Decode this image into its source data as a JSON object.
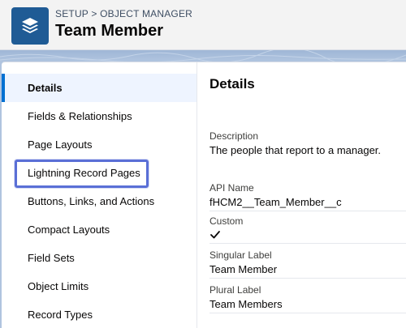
{
  "header": {
    "breadcrumb": {
      "setup": "SETUP",
      "separator": ">",
      "object_manager": "OBJECT MANAGER"
    },
    "title": "Team Member",
    "icon": "stack-layers-icon"
  },
  "sidebar": {
    "items": [
      {
        "label": "Details",
        "active": true
      },
      {
        "label": "Fields & Relationships"
      },
      {
        "label": "Page Layouts"
      },
      {
        "label": "Lightning Record Pages",
        "highlighted": true
      },
      {
        "label": "Buttons, Links, and Actions"
      },
      {
        "label": "Compact Layouts"
      },
      {
        "label": "Field Sets"
      },
      {
        "label": "Object Limits"
      },
      {
        "label": "Record Types"
      }
    ]
  },
  "details": {
    "title": "Details",
    "description": {
      "label": "Description",
      "value": "The people that report to a manager."
    },
    "api_name": {
      "label": "API Name",
      "value": "fHCM2__Team_Member__c"
    },
    "custom": {
      "label": "Custom",
      "icon": "checkmark-icon"
    },
    "singular_label": {
      "label": "Singular Label",
      "value": "Team Member"
    },
    "plural_label": {
      "label": "Plural Label",
      "value": "Team Members"
    }
  },
  "colors": {
    "accent": "#0070d2",
    "icon_bg": "#1f5b95",
    "highlight": "#5a6fd6",
    "active_bg": "#eef4ff"
  }
}
